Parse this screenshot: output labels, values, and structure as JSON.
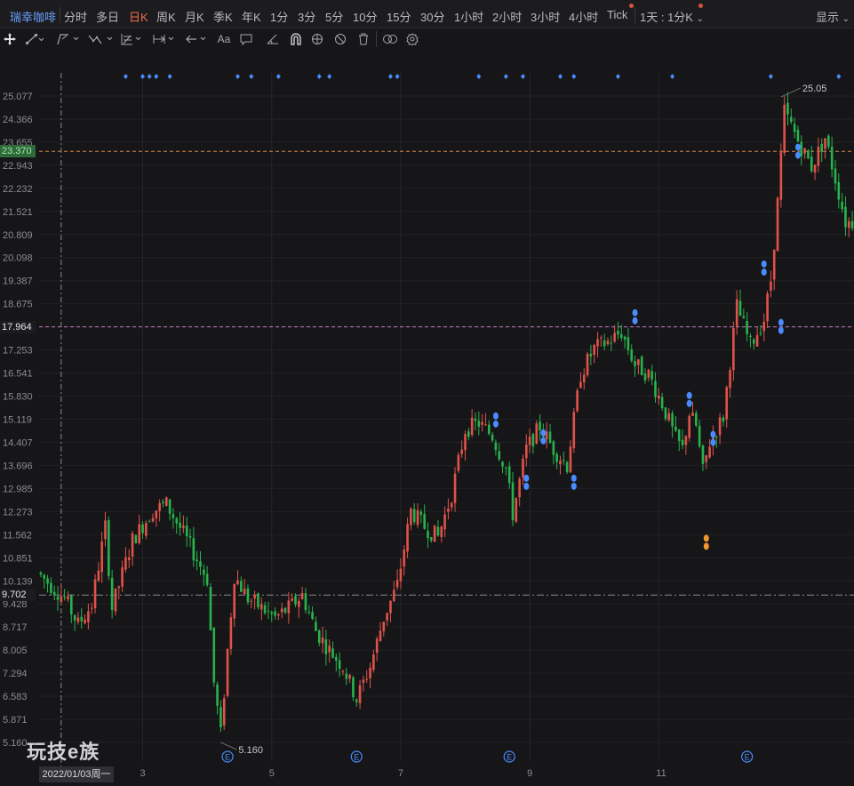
{
  "topbar": {
    "title": "瑞幸咖啡",
    "timeframes": [
      "分时",
      "多日",
      "日K",
      "周K",
      "月K",
      "季K",
      "年K",
      "1分",
      "3分",
      "5分",
      "10分",
      "15分",
      "30分",
      "1小时",
      "2小时",
      "3小时",
      "4小时",
      "Tick"
    ],
    "active": "日K",
    "combo": "1天 : 1分K",
    "display": "显示"
  },
  "toolbar": {
    "icons": [
      "move-icon",
      "line-tool-icon",
      "channel-tool-icon",
      "wave-tool-icon",
      "fib-tool-icon",
      "measure-tool-icon",
      "arrow-tool-icon",
      "text-tool-icon",
      "comment-tool-icon",
      "angle-tool-icon",
      "magnet-icon",
      "lock-tool-icon",
      "hide-tool-icon",
      "delete-icon",
      "link-icon",
      "settings-icon"
    ],
    "text_label": "Aa"
  },
  "watermark": "玩技e族",
  "colors": {
    "up": "#e0524a",
    "down": "#27b34c",
    "ref_orange": "#d98a4a",
    "ref_pink": "#c27ac4",
    "ref_gray": "#8a8a8e",
    "marker_blue": "#4a8cff"
  },
  "chart_data": {
    "type": "candlestick",
    "y_ticks": [
      "25.077",
      "24.366",
      "23.655",
      "22.943",
      "22.232",
      "21.521",
      "20.809",
      "20.098",
      "19.387",
      "18.675",
      "17.964",
      "17.253",
      "16.541",
      "15.830",
      "15.119",
      "14.407",
      "13.696",
      "12.985",
      "12.273",
      "11.562",
      "10.851",
      "10.139",
      "9.428",
      "8.717",
      "8.005",
      "7.294",
      "6.583",
      "5.871",
      "5.160"
    ],
    "ylim": [
      5.0,
      25.6
    ],
    "x_ticks": [
      {
        "label": "3",
        "day": 30
      },
      {
        "label": "5",
        "day": 68
      },
      {
        "label": "7",
        "day": 106
      },
      {
        "label": "9",
        "day": 144
      },
      {
        "label": "11",
        "day": 182
      }
    ],
    "date_label": "2022/01/03周一",
    "crosshair_day": 6,
    "ref_lines": [
      {
        "value": 23.37,
        "label": "23.370",
        "style": "dashed",
        "color": "#d98a4a"
      },
      {
        "value": 17.964,
        "label": "17.964",
        "style": "dashed",
        "color": "#c27ac4"
      },
      {
        "value": 9.702,
        "label": "9.702",
        "style": "dashdot",
        "color": "#8a8a8e"
      }
    ],
    "annotations": [
      {
        "text": "5.160",
        "day": 53,
        "value": 5.16,
        "note": "min"
      },
      {
        "text": "25.05",
        "day": 218,
        "value": 25.05,
        "note": "max"
      }
    ],
    "event_markers": [
      {
        "label": "E",
        "day": 55
      },
      {
        "label": "E",
        "day": 93
      },
      {
        "label": "E",
        "day": 138
      },
      {
        "label": "E",
        "day": 208
      }
    ],
    "anchors": [
      [
        0,
        10.4
      ],
      [
        8,
        9.6
      ],
      [
        12,
        8.8
      ],
      [
        16,
        9.4
      ],
      [
        20,
        11.8
      ],
      [
        22,
        9.3
      ],
      [
        28,
        11.4
      ],
      [
        34,
        12.3
      ],
      [
        38,
        12.5
      ],
      [
        44,
        11.4
      ],
      [
        50,
        10.2
      ],
      [
        52,
        7.0
      ],
      [
        54,
        5.4
      ],
      [
        56,
        8.0
      ],
      [
        58,
        10.3
      ],
      [
        62,
        9.6
      ],
      [
        66,
        9.3
      ],
      [
        70,
        9.0
      ],
      [
        74,
        9.3
      ],
      [
        78,
        9.7
      ],
      [
        82,
        8.6
      ],
      [
        86,
        8.0
      ],
      [
        90,
        7.5
      ],
      [
        94,
        6.5
      ],
      [
        98,
        7.5
      ],
      [
        102,
        9.0
      ],
      [
        106,
        10.0
      ],
      [
        110,
        12.3
      ],
      [
        114,
        11.8
      ],
      [
        118,
        11.5
      ],
      [
        122,
        12.8
      ],
      [
        126,
        14.8
      ],
      [
        130,
        15.0
      ],
      [
        134,
        14.6
      ],
      [
        138,
        13.6
      ],
      [
        140,
        12.2
      ],
      [
        144,
        14.2
      ],
      [
        148,
        14.9
      ],
      [
        152,
        14.2
      ],
      [
        156,
        13.7
      ],
      [
        160,
        16.5
      ],
      [
        164,
        17.3
      ],
      [
        168,
        17.5
      ],
      [
        172,
        17.8
      ],
      [
        176,
        16.8
      ],
      [
        180,
        16.5
      ],
      [
        184,
        15.6
      ],
      [
        188,
        14.5
      ],
      [
        190,
        14.2
      ],
      [
        192,
        15.3
      ],
      [
        194,
        14.9
      ],
      [
        196,
        13.5
      ],
      [
        198,
        14.4
      ],
      [
        202,
        15.2
      ],
      [
        206,
        18.6
      ],
      [
        210,
        17.4
      ],
      [
        214,
        18.2
      ],
      [
        216,
        19.4
      ],
      [
        218,
        21.8
      ],
      [
        220,
        24.6
      ],
      [
        224,
        23.7
      ],
      [
        228,
        22.9
      ],
      [
        232,
        23.8
      ],
      [
        236,
        22.1
      ],
      [
        238,
        21.2
      ]
    ],
    "marker_clusters": [
      {
        "day": 134,
        "value": 15.22,
        "count": 2,
        "color": "blue"
      },
      {
        "day": 143,
        "value": 13.3,
        "count": 2,
        "color": "blue"
      },
      {
        "day": 148,
        "value": 14.7,
        "count": 2,
        "color": "blue"
      },
      {
        "day": 157,
        "value": 13.3,
        "count": 2,
        "color": "blue"
      },
      {
        "day": 175,
        "value": 18.4,
        "count": 2,
        "color": "blue"
      },
      {
        "day": 191,
        "value": 15.85,
        "count": 2,
        "color": "blue"
      },
      {
        "day": 196,
        "value": 11.45,
        "count": 2,
        "color": "orange"
      },
      {
        "day": 198,
        "value": 14.65,
        "count": 2,
        "color": "blue"
      },
      {
        "day": 213,
        "value": 19.9,
        "count": 2,
        "color": "blue"
      },
      {
        "day": 218,
        "value": 18.1,
        "count": 2,
        "color": "blue"
      },
      {
        "day": 223,
        "value": 23.5,
        "count": 2,
        "color": "blue"
      }
    ],
    "top_dots": [
      25,
      30,
      32,
      34,
      38,
      58,
      62,
      70,
      82,
      85,
      103,
      105,
      129,
      137,
      142,
      153,
      157,
      170,
      186,
      215,
      235
    ]
  }
}
